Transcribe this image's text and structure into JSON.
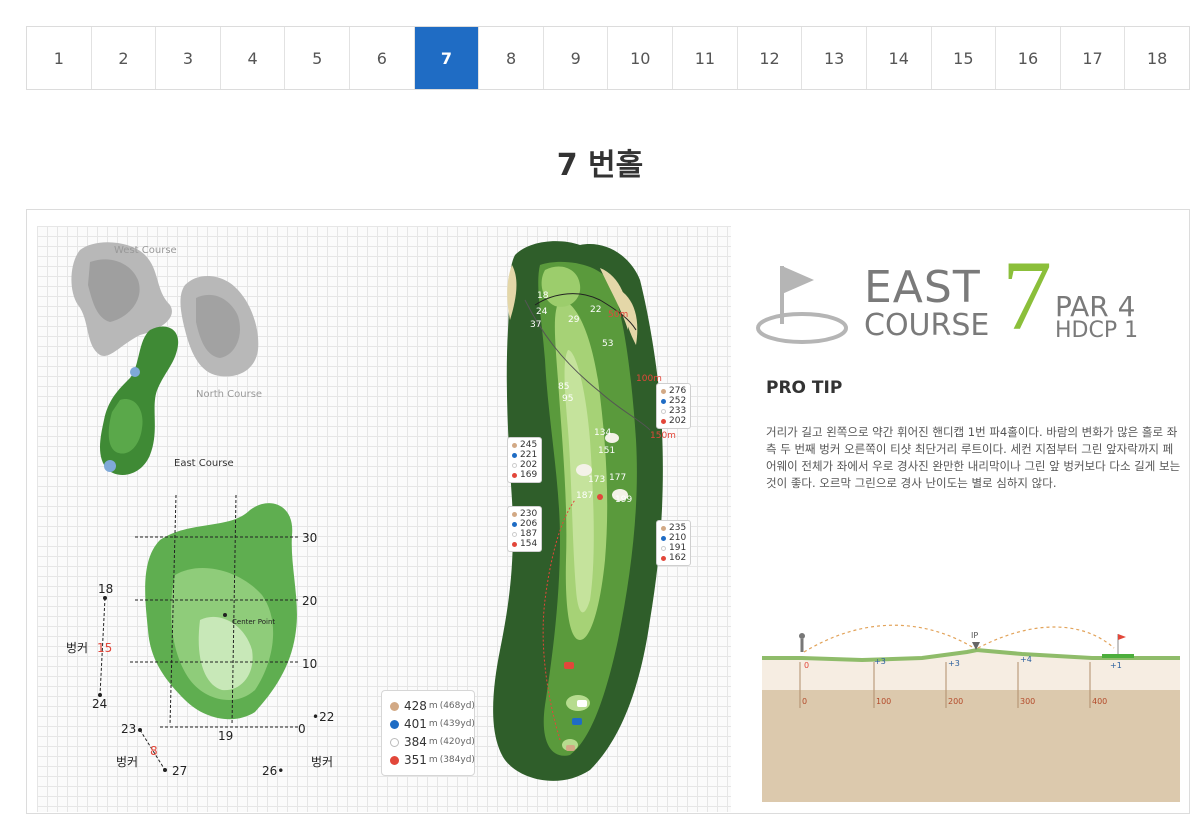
{
  "holes": [
    "1",
    "2",
    "3",
    "4",
    "5",
    "6",
    "7",
    "8",
    "9",
    "10",
    "11",
    "12",
    "13",
    "14",
    "15",
    "16",
    "17",
    "18"
  ],
  "active_hole": "7",
  "page_title": "7 번홀",
  "overview": {
    "west_course": "West Course",
    "north_course": "North Course",
    "east_course": "East Course"
  },
  "green_diagram": {
    "center_point": "Center Point",
    "grid_labels": [
      "30",
      "20",
      "10",
      "0"
    ],
    "left_bunker_label": "벙커",
    "left_bunker_depth": "15",
    "left_top": "18",
    "left_bottom": "24",
    "bottom_bunker_label": "벙커",
    "bottom_bunker_depth": "8",
    "bottom_left_top": "23",
    "bottom_left_bottom": "27",
    "front_edge": "19",
    "right_point": "•22",
    "right_low": "26•",
    "right_bunker_label": "벙커"
  },
  "tee_legend": [
    {
      "m": "428",
      "unit": "m",
      "yd": "(468yd)",
      "color": "#d2a985"
    },
    {
      "m": "401",
      "unit": "m",
      "yd": "(439yd)",
      "color": "#1f6cc4"
    },
    {
      "m": "384",
      "unit": "m",
      "yd": "(420yd)",
      "color": "#ffffff"
    },
    {
      "m": "351",
      "unit": "m",
      "yd": "(384yd)",
      "color": "#e2473a"
    }
  ],
  "hole_map": {
    "markers": [
      "50m",
      "100m",
      "150m"
    ],
    "distance_boxes": [
      {
        "values": [
          "276",
          "252",
          "233",
          "202"
        ]
      },
      {
        "values": [
          "245",
          "221",
          "202",
          "169"
        ]
      },
      {
        "values": [
          "230",
          "206",
          "187",
          "154"
        ]
      },
      {
        "values": [
          "235",
          "210",
          "191",
          "162"
        ]
      }
    ],
    "spot_numbers": [
      "18",
      "24",
      "29",
      "37",
      "22",
      "53",
      "85",
      "95",
      "134",
      "151",
      "173",
      "177",
      "187",
      "199"
    ]
  },
  "logo": {
    "east": "EAST",
    "course": "COURSE",
    "number": "7",
    "par": "PAR 4",
    "hdcp": "HDCP 1"
  },
  "pro_tip": {
    "title": "PRO TIP",
    "text": "거리가 길고 왼쪽으로 약간 휘어진 핸디캡 1번 파4홀이다. 바람의 변화가 많은 홀로 좌측 두 번째 벙커 오른쪽이 티샷 최단거리 루트이다. 세컨 지점부터 그린 앞자락까지 페어웨이 전체가 좌에서 우로 경사진 완만한 내리막이나 그린 앞 벙커보다 다소 길게 보는 것이 좋다. 오르막 그린으로 경사 난이도는 별로 심하지 않다."
  },
  "elevation_profile": {
    "ip_label": "IP",
    "heights": [
      "0",
      "+3",
      "+3",
      "+4",
      "+1"
    ],
    "distances": [
      "0",
      "100",
      "200",
      "300",
      "400"
    ]
  },
  "colors": {
    "accent": "#1f6cc4",
    "logo_green": "#8bbf3a",
    "marker_red": "#e2473a"
  }
}
